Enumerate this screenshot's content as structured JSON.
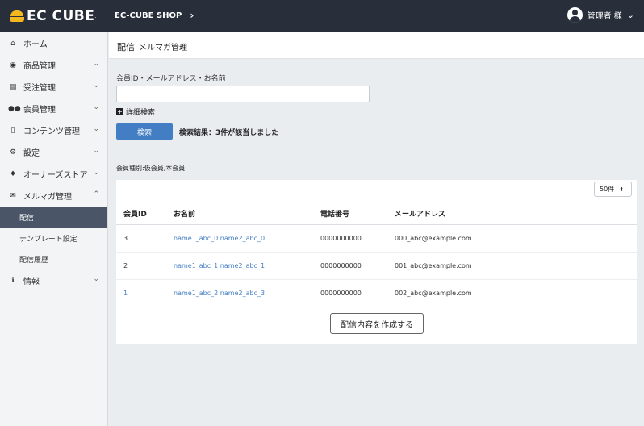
{
  "header": {
    "logo_text": "EC CUBE",
    "logo_tm": ".",
    "shop_name": "EC-CUBE SHOP",
    "shop_chevron": "›",
    "user_name": "管理者 様",
    "user_chevron": "⌄"
  },
  "sidebar": {
    "items": [
      {
        "label": "ホーム",
        "icon": "⌂",
        "arrow": ""
      },
      {
        "label": "商品管理",
        "icon": "◉",
        "arrow": "⌄"
      },
      {
        "label": "受注管理",
        "icon": "▤",
        "arrow": "⌄"
      },
      {
        "label": "会員管理",
        "icon": "●●",
        "arrow": "⌄"
      },
      {
        "label": "コンテンツ管理",
        "icon": "▯",
        "arrow": "⌄"
      },
      {
        "label": "設定",
        "icon": "⚙",
        "arrow": "⌄"
      },
      {
        "label": "オーナーズストア",
        "icon": "♦",
        "arrow": "⌄"
      },
      {
        "label": "メルマガ管理",
        "icon": "✉",
        "arrow": "⌃"
      }
    ],
    "sub_items": [
      {
        "label": "配信"
      },
      {
        "label": "テンプレート設定"
      },
      {
        "label": "配信履歴"
      }
    ],
    "info": {
      "label": "情報",
      "icon": "ℹ",
      "arrow": "⌄"
    }
  },
  "page": {
    "title": "配信",
    "subtitle": "メルマガ管理"
  },
  "search": {
    "label": "会員ID・メールアドレス・お名前",
    "value": "",
    "advanced_label": "詳細検索",
    "advanced_icon": "+",
    "button_label": "検索",
    "result_text": "検索結果：3件が該当しました"
  },
  "member_type": "会員種別:仮会員,本会員",
  "per_page": {
    "value": "50件",
    "caret": "⬍"
  },
  "table": {
    "headers": [
      "会員ID",
      "お名前",
      "電話番号",
      "メールアドレス"
    ],
    "rows": [
      {
        "id": "3",
        "name": "name1_abc_0 name2_abc_0",
        "phone": "0000000000",
        "email": "000_abc@example.com"
      },
      {
        "id": "2",
        "name": "name1_abc_1 name2_abc_1",
        "phone": "0000000000",
        "email": "001_abc@example.com"
      },
      {
        "id": "1",
        "name": "name1_abc_2 name2_abc_3",
        "phone": "0000000000",
        "email": "002_abc@example.com"
      }
    ]
  },
  "create_button": "配信内容を作成する",
  "colors": {
    "header_bg": "#282f3a",
    "primary": "#437ec4",
    "logo": "#f3b81f",
    "active_nav": "#4a5568"
  }
}
